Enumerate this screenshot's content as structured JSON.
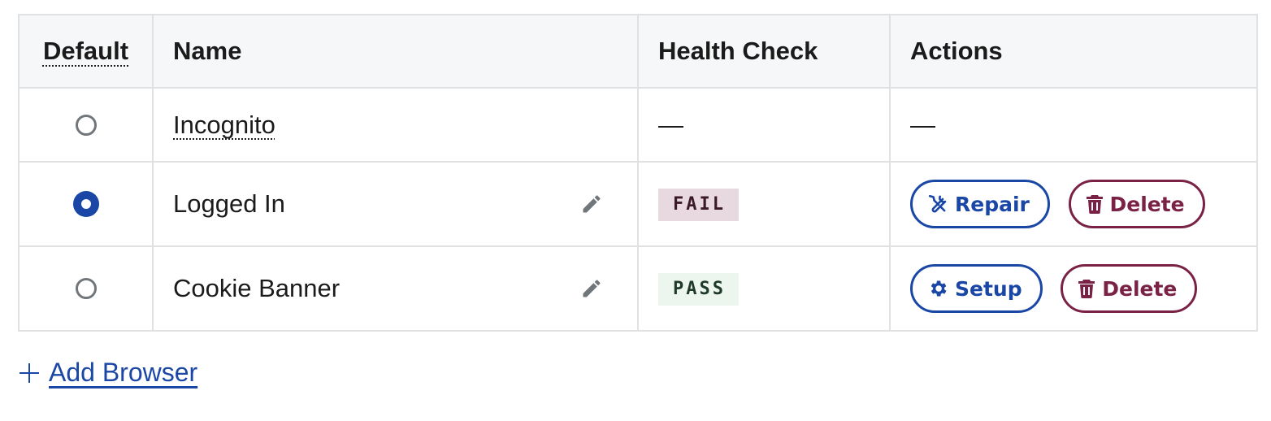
{
  "table": {
    "headers": {
      "default": "Default",
      "name": "Name",
      "health": "Health Check",
      "actions": "Actions"
    },
    "rows": [
      {
        "selected": false,
        "name": "Incognito",
        "health": "—",
        "actions_text": "—",
        "actions": []
      },
      {
        "selected": true,
        "name": "Logged In",
        "health": "FAIL",
        "actions": [
          {
            "label": "Repair",
            "icon": "wrench-screwdriver-icon"
          },
          {
            "label": "Delete",
            "icon": "trash-icon"
          }
        ]
      },
      {
        "selected": false,
        "name": "Cookie Banner",
        "health": "PASS",
        "actions": [
          {
            "label": "Setup",
            "icon": "gear-icon"
          },
          {
            "label": "Delete",
            "icon": "trash-icon"
          }
        ]
      }
    ]
  },
  "add_browser": {
    "label": "Add Browser",
    "icon": "plus-icon"
  },
  "colors": {
    "primary": "#1a47a6",
    "danger": "#7a2245",
    "fail_bg": "#e8d8df",
    "pass_bg": "#ecf6ef",
    "header_bg": "#f6f7f9",
    "border": "#dfe1e2"
  }
}
